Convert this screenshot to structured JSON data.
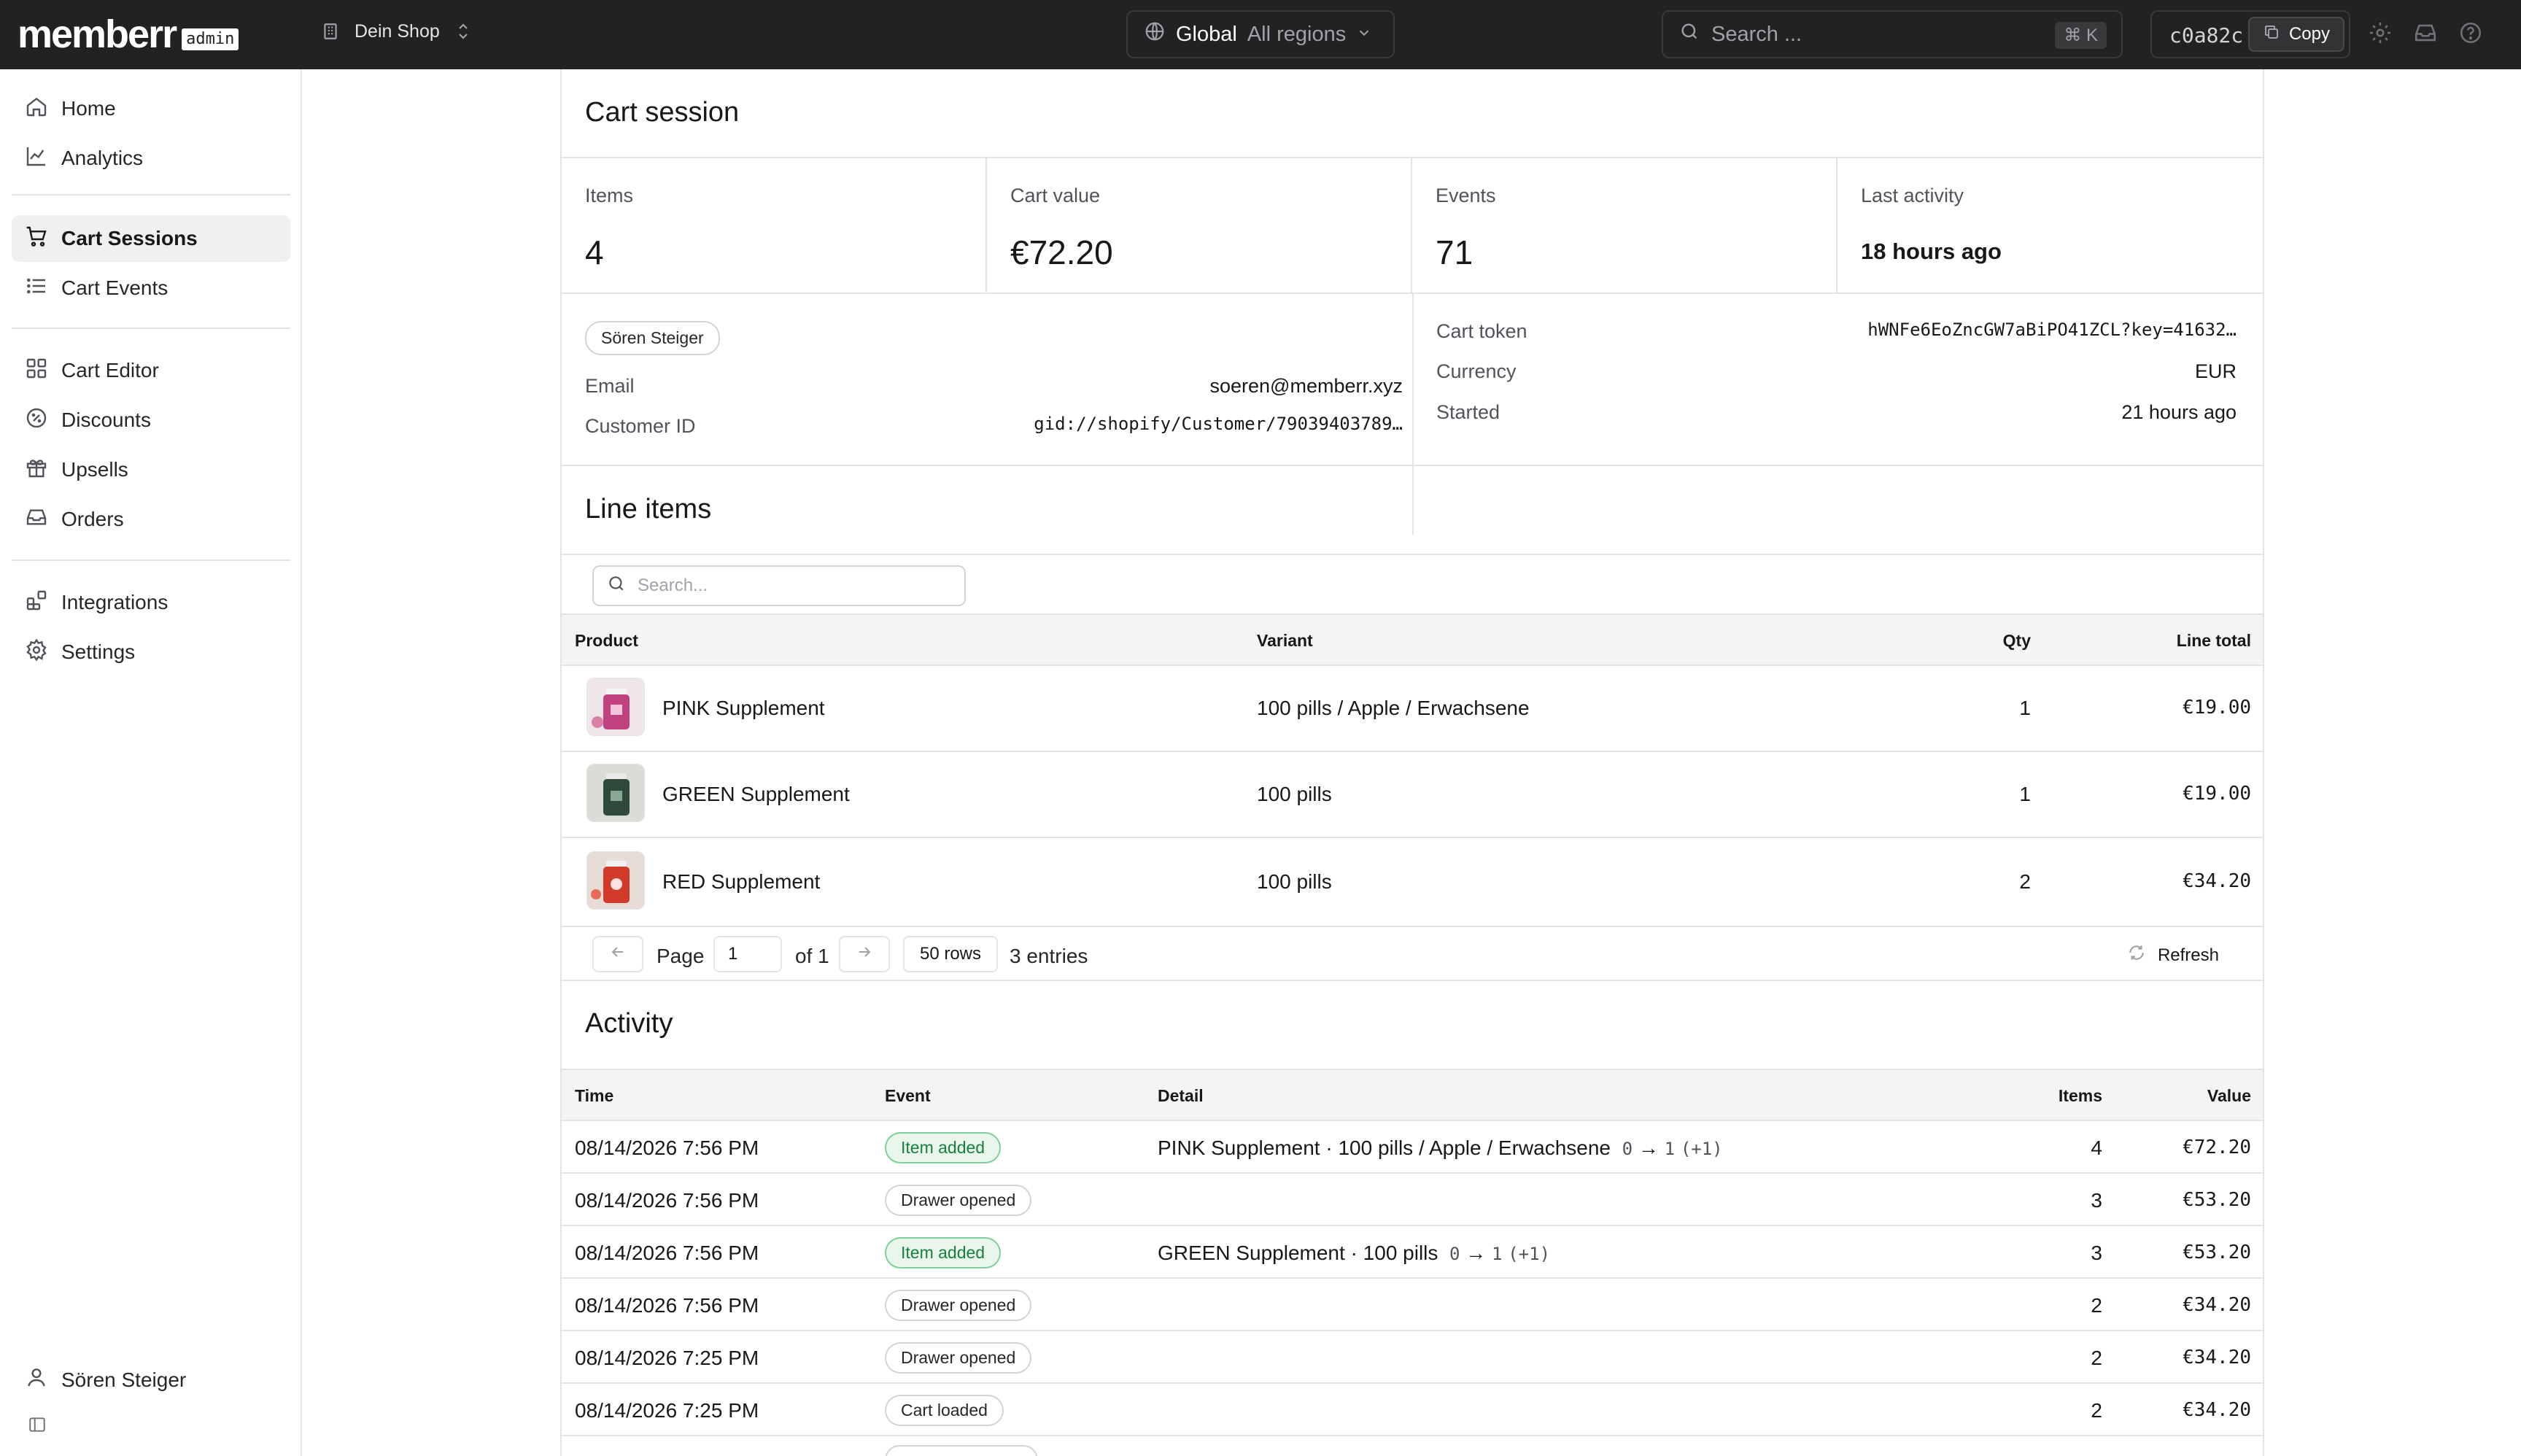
{
  "topbar": {
    "logo": "memberr",
    "logo_badge": "admin",
    "shop_name": "Dein Shop",
    "region_primary": "Global",
    "region_secondary": "All regions",
    "search_placeholder": "Search ...",
    "search_shortcut": "⌘ K",
    "id_value": "c0a82c",
    "copy_label": "Copy"
  },
  "sidebar": {
    "items": [
      {
        "label": "Home",
        "icon": "home-icon"
      },
      {
        "label": "Analytics",
        "icon": "chart-line-icon"
      },
      {
        "label": "Cart Sessions",
        "icon": "cart-icon"
      },
      {
        "label": "Cart Events",
        "icon": "list-icon"
      },
      {
        "label": "Cart Editor",
        "icon": "grid-icon"
      },
      {
        "label": "Discounts",
        "icon": "discount-icon"
      },
      {
        "label": "Upsells",
        "icon": "gift-icon"
      },
      {
        "label": "Orders",
        "icon": "inbox-icon"
      },
      {
        "label": "Integrations",
        "icon": "integrations-icon"
      },
      {
        "label": "Settings",
        "icon": "gear-icon"
      }
    ],
    "user_name": "Sören Steiger"
  },
  "session": {
    "title": "Cart session",
    "stats": [
      {
        "label": "Items",
        "value": "4"
      },
      {
        "label": "Cart value",
        "value": "€72.20"
      },
      {
        "label": "Events",
        "value": "71"
      },
      {
        "label": "Last activity",
        "value": "18 hours ago"
      }
    ],
    "customer_chip": "Sören Steiger",
    "email_label": "Email",
    "email_value": "soeren@memberr.xyz",
    "customer_id_label": "Customer ID",
    "customer_id_value": "gid://shopify/Customer/79039403789…",
    "cart_token_label": "Cart token",
    "cart_token_value": "hWNFe6EoZncGW7aBiPO41ZCL?key=41632…",
    "currency_label": "Currency",
    "currency_value": "EUR",
    "started_label": "Started",
    "started_value": "21 hours ago"
  },
  "line_items": {
    "title": "Line items",
    "search_placeholder": "Search...",
    "columns": {
      "product": "Product",
      "variant": "Variant",
      "qty": "Qty",
      "total": "Line total"
    },
    "rows": [
      {
        "product": "PINK Supplement",
        "variant": "100 pills / Apple / Erwachsene",
        "qty": "1",
        "total": "€19.00",
        "color": "#c0427e"
      },
      {
        "product": "GREEN Supplement",
        "variant": "100 pills",
        "qty": "1",
        "total": "€19.00",
        "color": "#2f4a3a"
      },
      {
        "product": "RED Supplement",
        "variant": "100 pills",
        "qty": "2",
        "total": "€34.20",
        "color": "#d23a2c"
      }
    ],
    "pager": {
      "page_label": "Page",
      "page_value": "1",
      "of_label": "of 1",
      "rows_label": "50 rows",
      "entries_label": "3 entries",
      "refresh_label": "Refresh"
    }
  },
  "activity": {
    "title": "Activity",
    "columns": {
      "time": "Time",
      "event": "Event",
      "detail": "Detail",
      "items": "Items",
      "value": "Value"
    },
    "rows": [
      {
        "time": "08/14/2026 7:56 PM",
        "event": "Item added",
        "variant": "green",
        "detail": "PINK Supplement · 100 pills / Apple / Erwachsene",
        "from": "0",
        "arrow": "→",
        "to": "1",
        "delta": "(+1)",
        "items": "4",
        "value": "€72.20"
      },
      {
        "time": "08/14/2026 7:56 PM",
        "event": "Drawer opened",
        "variant": "gray",
        "detail": "",
        "from": "",
        "arrow": "",
        "to": "",
        "delta": "",
        "items": "3",
        "value": "€53.20"
      },
      {
        "time": "08/14/2026 7:56 PM",
        "event": "Item added",
        "variant": "green",
        "detail": "GREEN Supplement · 100 pills",
        "from": "0",
        "arrow": "→",
        "to": "1",
        "delta": "(+1)",
        "items": "3",
        "value": "€53.20"
      },
      {
        "time": "08/14/2026 7:56 PM",
        "event": "Drawer opened",
        "variant": "gray",
        "detail": "",
        "from": "",
        "arrow": "",
        "to": "",
        "delta": "",
        "items": "2",
        "value": "€34.20"
      },
      {
        "time": "08/14/2026 7:25 PM",
        "event": "Drawer opened",
        "variant": "gray",
        "detail": "",
        "from": "",
        "arrow": "",
        "to": "",
        "delta": "",
        "items": "2",
        "value": "€34.20"
      },
      {
        "time": "08/14/2026 7:25 PM",
        "event": "Cart loaded",
        "variant": "gray",
        "detail": "",
        "from": "",
        "arrow": "",
        "to": "",
        "delta": "",
        "items": "2",
        "value": "€34.20"
      }
    ]
  }
}
